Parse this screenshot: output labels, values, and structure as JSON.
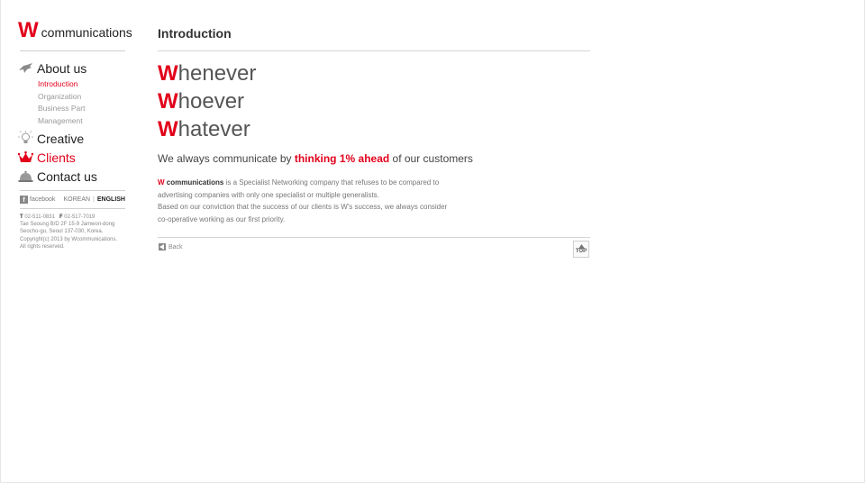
{
  "logo": {
    "mark": "W",
    "text": "communications"
  },
  "nav": {
    "about": {
      "label": "About us",
      "icon": "bird-icon"
    },
    "about_sub": [
      {
        "label": "Introduction",
        "active": true
      },
      {
        "label": "Organization",
        "active": false
      },
      {
        "label": "Business Part",
        "active": false
      },
      {
        "label": "Management",
        "active": false
      }
    ],
    "creative": {
      "label": "Creative",
      "icon": "lightbulb-icon"
    },
    "clients": {
      "label": "Clients",
      "icon": "crown-icon"
    },
    "contact": {
      "label": "Contact us",
      "icon": "bell-icon"
    }
  },
  "social": {
    "facebook": "facebook",
    "lang_korean": "KOREAN",
    "lang_sep": "|",
    "lang_english": "ENGLISH"
  },
  "contact": {
    "t_label": "T",
    "phone": "02-511-0831",
    "f_label": "F",
    "fax": "02-517-7019",
    "address1": "Tae Seoung B/D 2F 15-9 Jamwon-dong",
    "address2": "Seocho-gu, Seoul 137-030, Korea.",
    "copyright1": "Copyright(c) 2013 by Wcommunications.",
    "copyright2": "All rights reserved."
  },
  "main": {
    "title": "Introduction",
    "slogan": [
      {
        "cap": "W",
        "rest": "henever"
      },
      {
        "cap": "W",
        "rest": "hoever"
      },
      {
        "cap": "W",
        "rest": "hatever"
      }
    ],
    "tagline": {
      "before": "We always communicate by ",
      "highlight": "thinking 1% ahead",
      "after": " of our customers"
    },
    "desc": {
      "brand_w": "W",
      "brand_rest": " communications",
      "line1_rest": " is a Specialist Networking company that refuses to be compared to",
      "line2": "advertising companies with only one specialist or multiple generalists.",
      "line3": "Based on our conviction that the success of our clients is W's success, we always consider",
      "line4": "co-operative working as our first priority."
    },
    "back": "Back",
    "top": "TOP"
  },
  "colors": {
    "accent": "#e2001a",
    "text": "#333333",
    "muted": "#999999",
    "rule": "#d5d5d5"
  }
}
